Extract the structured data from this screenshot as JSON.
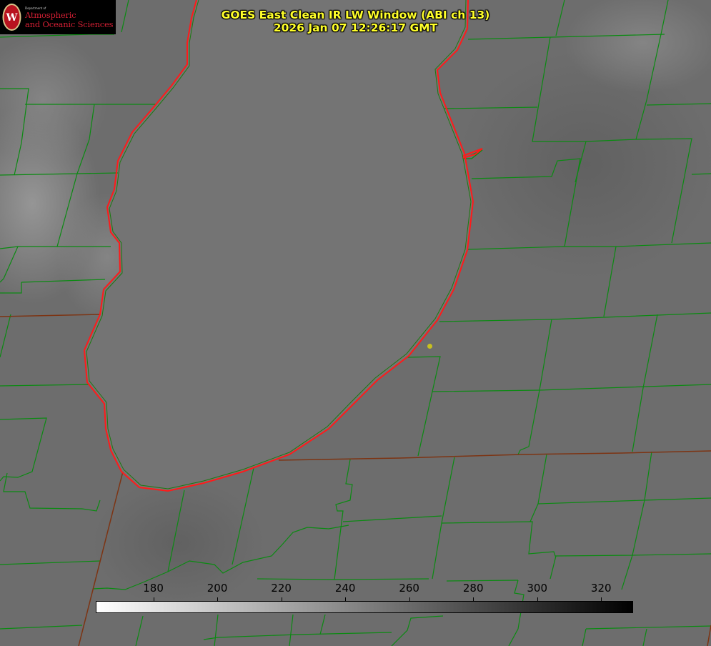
{
  "logo": {
    "small_text": "Department of",
    "line1": "Atmospheric",
    "line2": "and Oceanic Sciences",
    "seal_letter": "W",
    "colors": {
      "background": "#000000",
      "text": "#d51f34",
      "seal": "#b8131f"
    }
  },
  "title": {
    "line1": "GOES East Clean IR LW Window (ABI ch 13)",
    "line2": "2026 Jan 07 12:26:17 GMT",
    "color": "#ffff2a"
  },
  "colorbar": {
    "ticks": [
      "180",
      "200",
      "220",
      "240",
      "260",
      "280",
      "300",
      "320"
    ],
    "tick_values": [
      180,
      200,
      220,
      240,
      260,
      280,
      300,
      320
    ],
    "range": [
      162,
      330
    ],
    "gradient": [
      "#ffffff",
      "#000000"
    ]
  },
  "map": {
    "colors": {
      "county_lines": "#0b8a12",
      "state_lines": "#7d3413",
      "lake_shoreline": "#ff1a1a",
      "marker": "#c8c020",
      "background": "#6c6c6c"
    }
  }
}
